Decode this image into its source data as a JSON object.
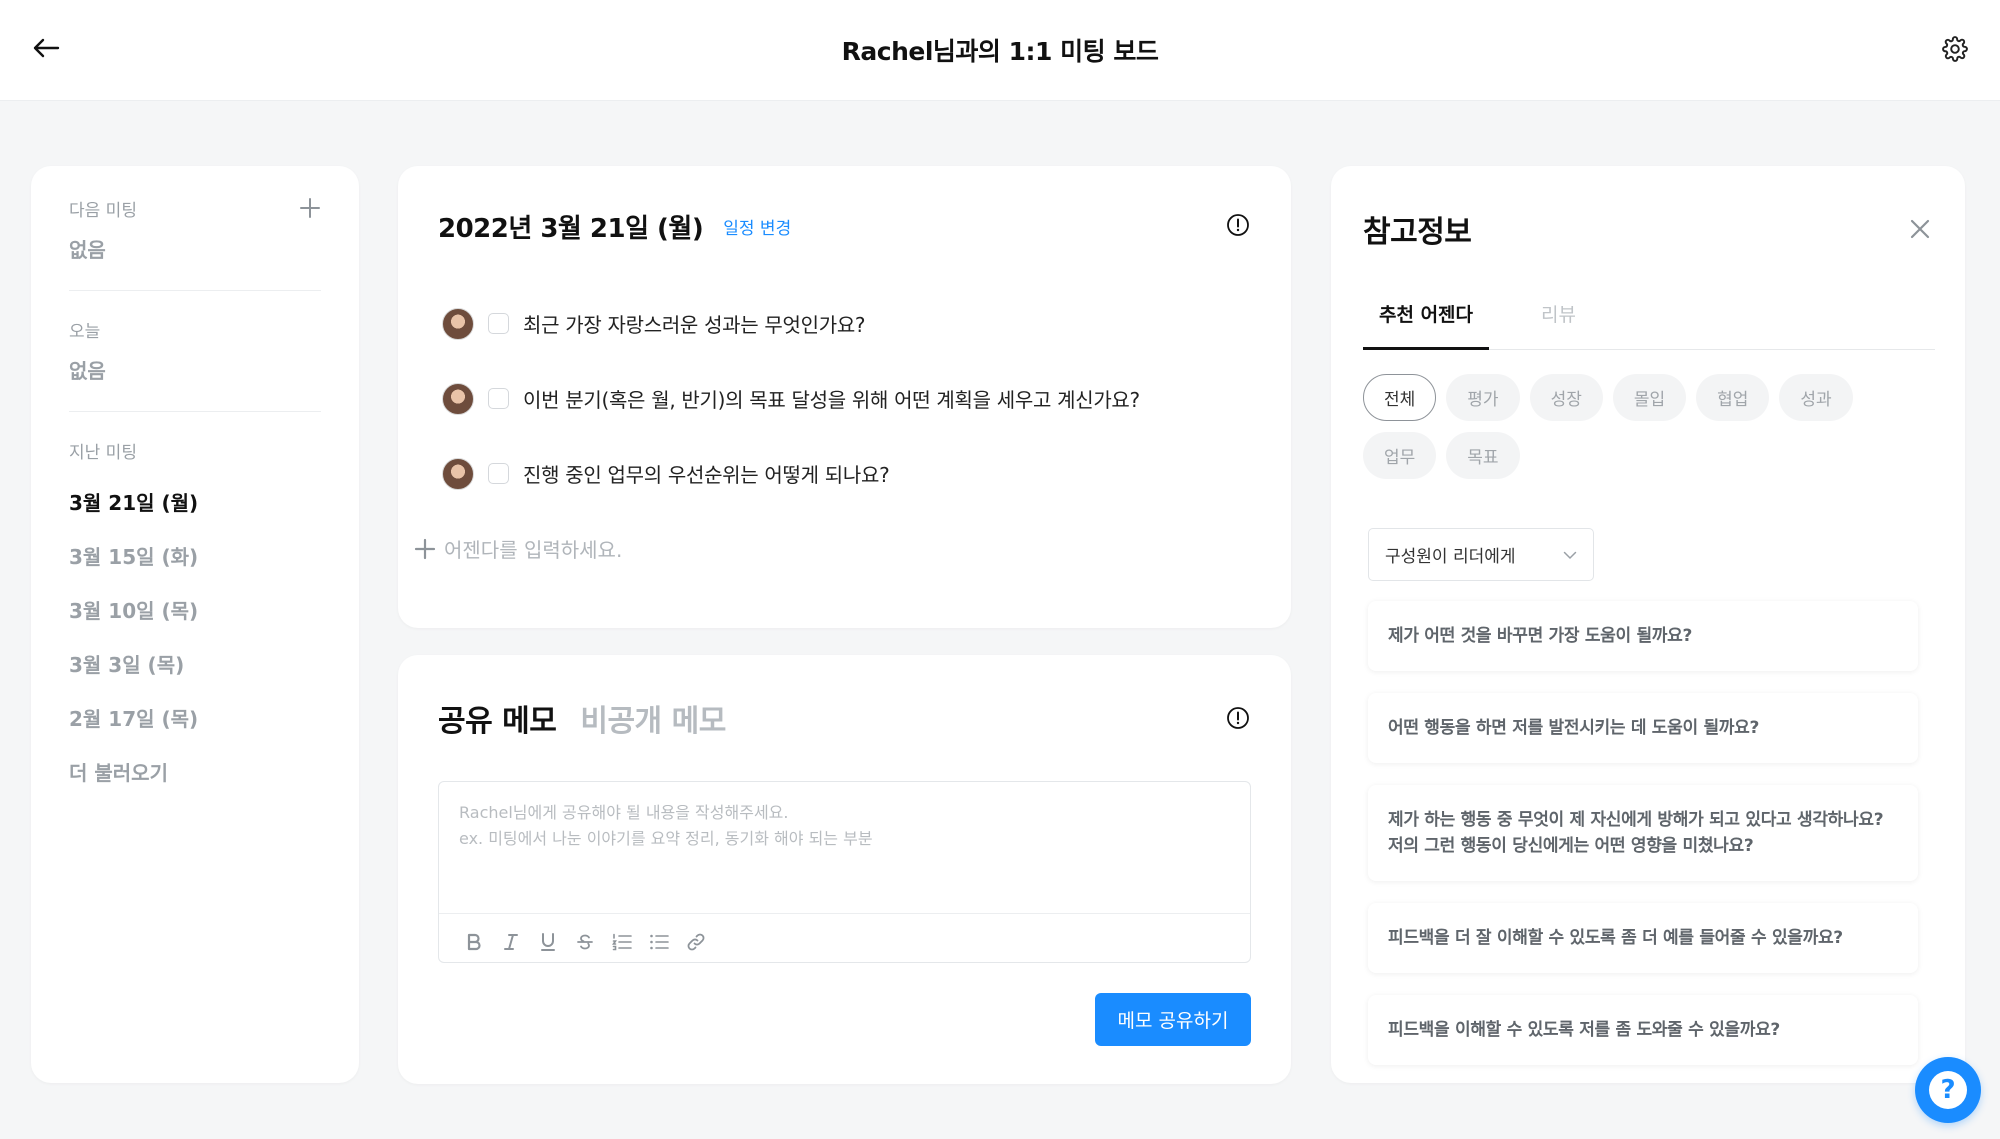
{
  "header": {
    "title": "Rachel님과의 1:1 미팅 보드"
  },
  "sidebar": {
    "next_label": "다음 미팅",
    "next_value": "없음",
    "today_label": "오늘",
    "today_value": "없음",
    "past_label": "지난 미팅",
    "past_dates": [
      "3월 21일 (월)",
      "3월 15일 (화)",
      "3월 10일 (목)",
      "3월 3일 (목)",
      "2월 17일 (목)"
    ],
    "load_more": "더 불러오기"
  },
  "agenda": {
    "date": "2022년 3월 21일 (월)",
    "change_label": "일정 변경",
    "items": [
      "최근 가장 자랑스러운 성과는 무엇인가요?",
      "이번 분기(혹은 월, 반기)의 목표 달성을 위해 어떤 계획을 세우고 계신가요?",
      "진행 중인 업무의 우선순위는 어떻게 되나요?"
    ],
    "add_placeholder": "어젠다를 입력하세요."
  },
  "memo": {
    "tab_shared": "공유 메모",
    "tab_private": "비공개 메모",
    "placeholder": "Rachel님에게 공유해야 될 내용을 작성해주세요.\nex. 미팅에서 나눈 이야기를 요약 정리, 동기화 해야 되는 부분",
    "share_button": "메모 공유하기"
  },
  "reference": {
    "title": "참고정보",
    "tabs": [
      "추천 어젠다",
      "리뷰"
    ],
    "chips": [
      "전체",
      "평가",
      "성장",
      "몰입",
      "협업",
      "성과",
      "업무",
      "목표"
    ],
    "select_value": "구성원이 리더에게",
    "questions": [
      "제가 어떤 것을 바꾸면 가장 도움이 될까요?",
      "어떤 행동을 하면 저를 발전시키는 데 도움이 될까요?",
      "제가 하는 행동 중 무엇이 제 자신에게 방해가 되고 있다고 생각하나요? 저의 그런 행동이 당신에게는 어떤 영향을 미쳤나요?",
      "피드백을 더 잘 이해할 수 있도록 좀 더 예를 들어줄 수 있을까요?",
      "피드백을 이해할 수 있도록 저를 좀 도와줄 수 있을까요?"
    ]
  },
  "icons": {
    "back": "arrow-left-icon",
    "settings": "gear-icon",
    "add": "plus-icon",
    "info": "info-circle-icon",
    "close": "close-icon",
    "dropdown": "chevron-down-icon",
    "help": "question-icon"
  },
  "colors": {
    "accent": "#1a8cff",
    "background": "#f5f6f7",
    "muted": "#9aa0a6"
  }
}
